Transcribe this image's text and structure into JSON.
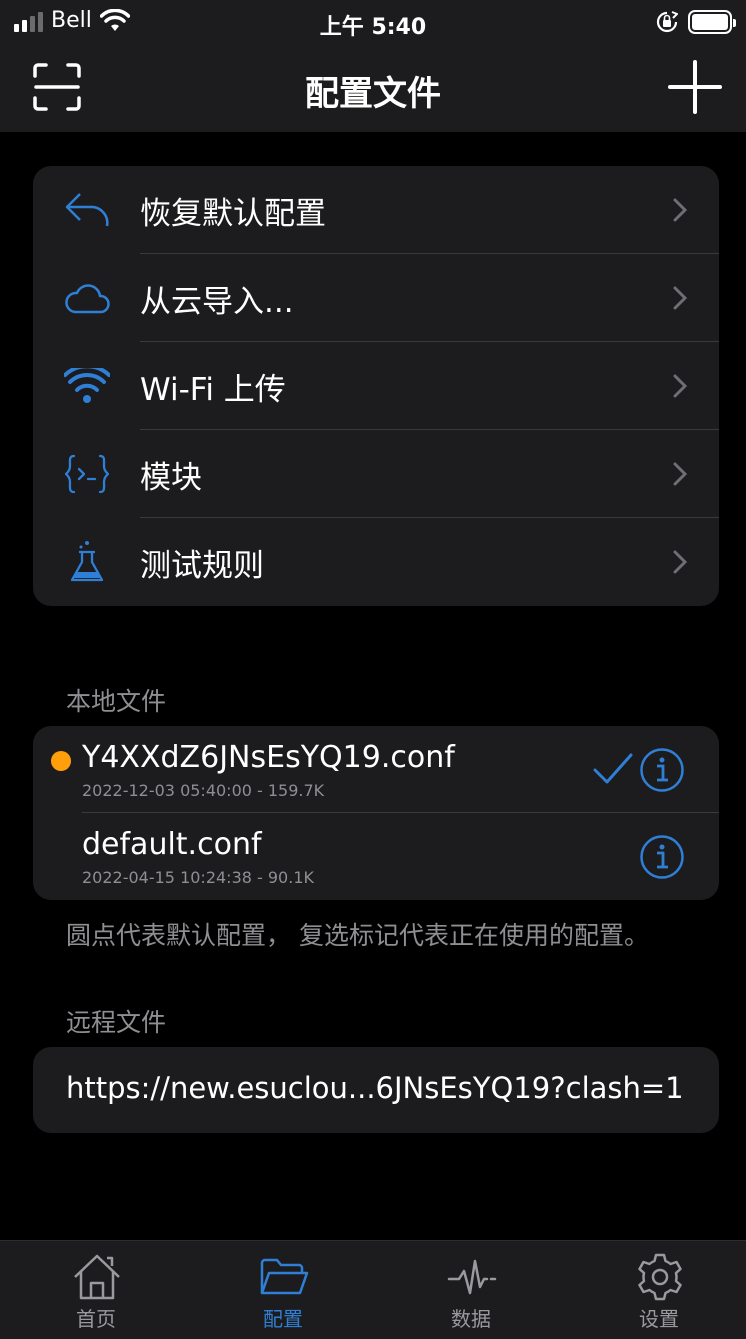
{
  "status_bar": {
    "carrier": "Bell",
    "time": "上午 5:40"
  },
  "nav": {
    "title": "配置文件",
    "scan_icon": "scan-icon",
    "add_icon": "plus-icon"
  },
  "menu": {
    "items": [
      {
        "label": "恢复默认配置",
        "icon": "undo-arrow-icon"
      },
      {
        "label": "从云导入...",
        "icon": "cloud-icon"
      },
      {
        "label": "Wi-Fi 上传",
        "icon": "wifi-icon"
      },
      {
        "label": "模块",
        "icon": "module-braces-icon"
      },
      {
        "label": "测试规则",
        "icon": "flask-icon"
      }
    ]
  },
  "local": {
    "header": "本地文件",
    "files": [
      {
        "name": "Y4XXdZ6JNsEsYQ19.conf",
        "meta": "2022-12-03 05:40:00 - 159.7K",
        "is_default": true,
        "in_use": true
      },
      {
        "name": "default.conf",
        "meta": "2022-04-15 10:24:38 - 90.1K",
        "is_default": false,
        "in_use": false
      }
    ],
    "footnote": "圆点代表默认配置， 复选标记代表正在使用的配置。"
  },
  "remote": {
    "header": "远程文件",
    "url": "https://new.esuclou...6JNsEsYQ19?clash=1"
  },
  "tabbar": {
    "tabs": [
      {
        "label": "首页",
        "icon": "home-icon",
        "active": false
      },
      {
        "label": "配置",
        "icon": "folder-icon",
        "active": true
      },
      {
        "label": "数据",
        "icon": "activity-icon",
        "active": false
      },
      {
        "label": "设置",
        "icon": "gear-icon",
        "active": false
      }
    ]
  },
  "colors": {
    "accent": "#2f7fd6",
    "default_dot": "#ff9f0a",
    "cell_bg": "#1c1c1e",
    "secondary_text": "#8e8e93"
  }
}
